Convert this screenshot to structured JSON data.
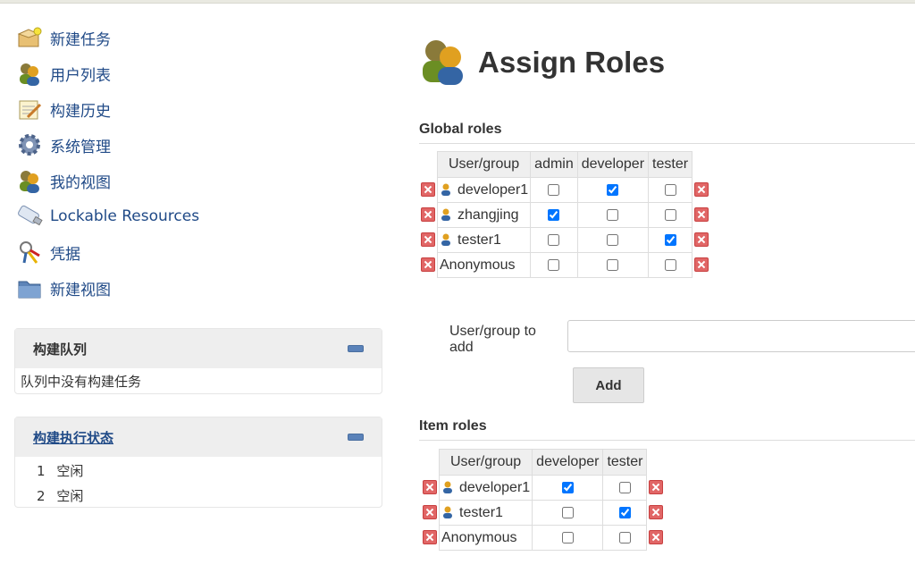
{
  "sidebar": {
    "tasks": [
      {
        "label": "新建任务",
        "icon": "new-package-icon"
      },
      {
        "label": "用户列表",
        "icon": "users-icon"
      },
      {
        "label": "构建历史",
        "icon": "notepad-icon"
      },
      {
        "label": "系统管理",
        "icon": "gear-icon"
      },
      {
        "label": "我的视图",
        "icon": "users-icon"
      },
      {
        "label": "Lockable Resources",
        "icon": "usb-drive-icon"
      },
      {
        "label": "凭据",
        "icon": "keys-icon"
      },
      {
        "label": "新建视图",
        "icon": "folder-icon"
      }
    ]
  },
  "build_queue": {
    "title": "构建队列",
    "empty_text": "队列中没有构建任务"
  },
  "executors": {
    "title": "构建执行状态",
    "rows": [
      {
        "num": "1",
        "status": "空闲"
      },
      {
        "num": "2",
        "status": "空闲"
      }
    ]
  },
  "main": {
    "title": "Assign Roles",
    "global_roles": {
      "heading": "Global roles",
      "header": [
        "User/group",
        "admin",
        "developer",
        "tester"
      ],
      "rows": [
        {
          "name": "developer1",
          "user_icon": true,
          "checks": [
            false,
            true,
            false
          ]
        },
        {
          "name": "zhangjing",
          "user_icon": true,
          "checks": [
            true,
            false,
            false
          ]
        },
        {
          "name": "tester1",
          "user_icon": true,
          "checks": [
            false,
            false,
            true
          ]
        },
        {
          "name": "Anonymous",
          "user_icon": false,
          "checks": [
            false,
            false,
            false
          ]
        }
      ]
    },
    "add": {
      "label": "User/group to add",
      "value": "",
      "button": "Add"
    },
    "item_roles": {
      "heading": "Item roles",
      "header": [
        "User/group",
        "developer",
        "tester"
      ],
      "rows": [
        {
          "name": "developer1",
          "user_icon": true,
          "checks": [
            true,
            false
          ]
        },
        {
          "name": "tester1",
          "user_icon": true,
          "checks": [
            false,
            true
          ]
        },
        {
          "name": "Anonymous",
          "user_icon": false,
          "checks": [
            false,
            false
          ]
        }
      ]
    }
  },
  "colors": {
    "link": "#204a87",
    "delete": "#e16666",
    "pane_header": "#eeeeee"
  }
}
